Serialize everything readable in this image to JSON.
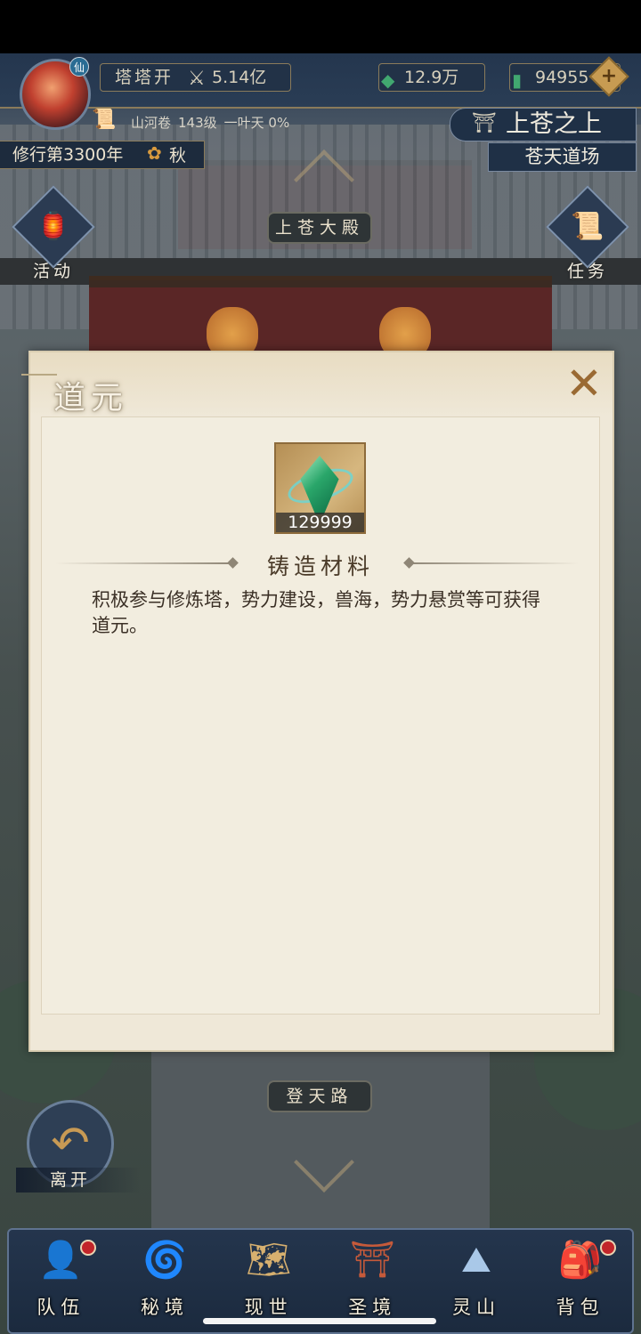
{
  "player": {
    "name": "塔塔开",
    "power": "5.14亿",
    "badge": "仙"
  },
  "resources": {
    "jade": "12.9万",
    "spirit_stone": "94955"
  },
  "realm": {
    "book": "山河卷",
    "level": "143级",
    "stage": "一叶天 0%"
  },
  "cultivation": {
    "year": "修行第3300年",
    "season": "秋"
  },
  "location": {
    "title": "上苍之上",
    "sub": "苍天道场"
  },
  "scene": {
    "upper_plate": "上苍大殿",
    "lower_plate": "登天路",
    "left_button": "活动",
    "right_button": "任务",
    "back_label": "离开"
  },
  "modal": {
    "title": "道元",
    "close": "✕",
    "item_count": "129999",
    "category": "铸造材料",
    "description": "积极参与修炼塔，势力建设，兽海，势力悬赏等可获得道元。"
  },
  "bottom_nav": {
    "items": [
      {
        "label": "队伍",
        "icon": "team-icon",
        "dot": true
      },
      {
        "label": "秘境",
        "icon": "vortex-icon",
        "dot": false
      },
      {
        "label": "现世",
        "icon": "scroll-map-icon",
        "dot": false
      },
      {
        "label": "圣境",
        "icon": "temple-icon",
        "dot": false
      },
      {
        "label": "灵山",
        "icon": "mountain-icon",
        "dot": false
      },
      {
        "label": "背包",
        "icon": "bag-icon",
        "dot": true
      }
    ]
  },
  "colors": {
    "accent_gold": "#c79b52",
    "panel_bg": "#efe8d8",
    "nav_bg": "#24354d",
    "alert_red": "#c2252a"
  }
}
